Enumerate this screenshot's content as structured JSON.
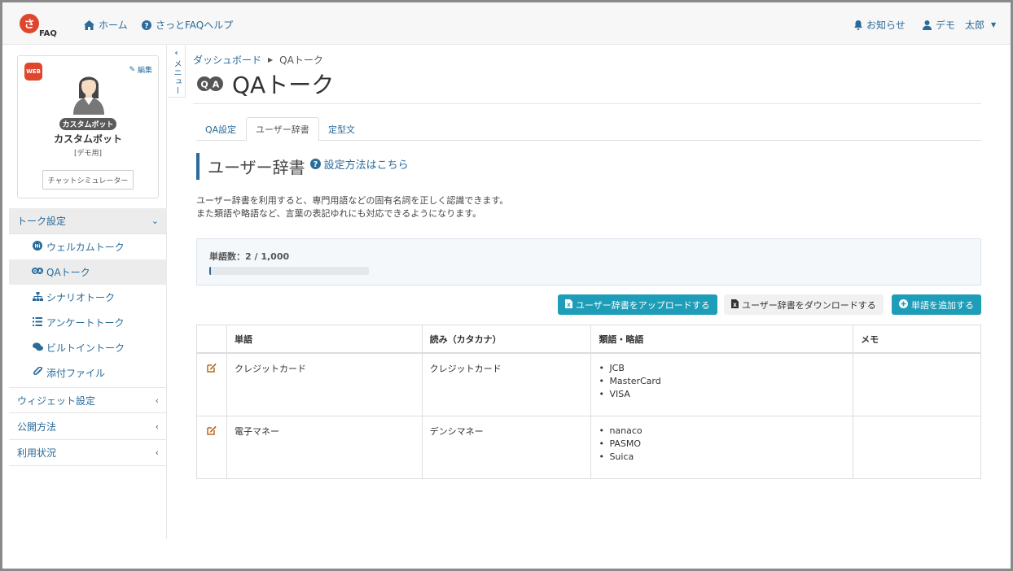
{
  "header": {
    "logo_text": "さっとFAQ",
    "home_label": "ホーム",
    "help_label": "さっとFAQヘルプ",
    "notice_label": "お知らせ",
    "user_label": "デモ　太郎"
  },
  "profile": {
    "web_badge": "WEB",
    "edit_label": "編集",
    "bot_pill": "カスタムボット",
    "bot_name": "カスタムボット",
    "bot_note": "[デモ用]",
    "simulator_label": "チャットシミュレーター"
  },
  "sidebar": {
    "talk_settings": "トーク設定",
    "items": [
      {
        "label": "ウェルカムトーク",
        "icon": "welcome-icon"
      },
      {
        "label": "QAトーク",
        "icon": "qa-icon"
      },
      {
        "label": "シナリオトーク",
        "icon": "sitemap-icon"
      },
      {
        "label": "アンケートトーク",
        "icon": "list-icon"
      },
      {
        "label": "ビルトイントーク",
        "icon": "comments-icon"
      },
      {
        "label": "添付ファイル",
        "icon": "paperclip-icon"
      }
    ],
    "widget_settings": "ウィジェット設定",
    "publish_method": "公開方法",
    "usage": "利用状況",
    "menu_tab_label": "メニュー"
  },
  "breadcrumb": {
    "dashboard": "ダッシュボード",
    "current": "QAトーク"
  },
  "page": {
    "title": "QAトーク"
  },
  "tabs": [
    {
      "label": "QA設定"
    },
    {
      "label": "ユーザー辞書"
    },
    {
      "label": "定型文"
    }
  ],
  "section": {
    "title": "ユーザー辞書",
    "help_link": "設定方法はこちら",
    "desc_line1": "ユーザー辞書を利用すると、専門用語などの固有名詞を正しく認識できます。",
    "desc_line2": "また類語や略語など、言葉の表記ゆれにも対応できるようになります。",
    "count_text": "単語数：2 /  1,000",
    "progress_fraction": 0.002
  },
  "buttons": {
    "upload": "ユーザー辞書をアップロードする",
    "download": "ユーザー辞書をダウンロードする",
    "add": "単語を追加する"
  },
  "table": {
    "headers": [
      "",
      "単語",
      "読み（カタカナ）",
      "類語・略語",
      "メモ"
    ],
    "rows": [
      {
        "word": "クレジットカード",
        "reading": "クレジットカード",
        "synonyms": [
          "JCB",
          "MasterCard",
          "VISA"
        ],
        "memo": ""
      },
      {
        "word": "電子マネー",
        "reading": "デンシマネー",
        "synonyms": [
          "nanaco",
          "PASMO",
          "Suica"
        ],
        "memo": ""
      }
    ]
  },
  "colors": {
    "link": "#2a6b9a",
    "teal_button": "#1e9db9",
    "logo_red": "#e0452e"
  }
}
